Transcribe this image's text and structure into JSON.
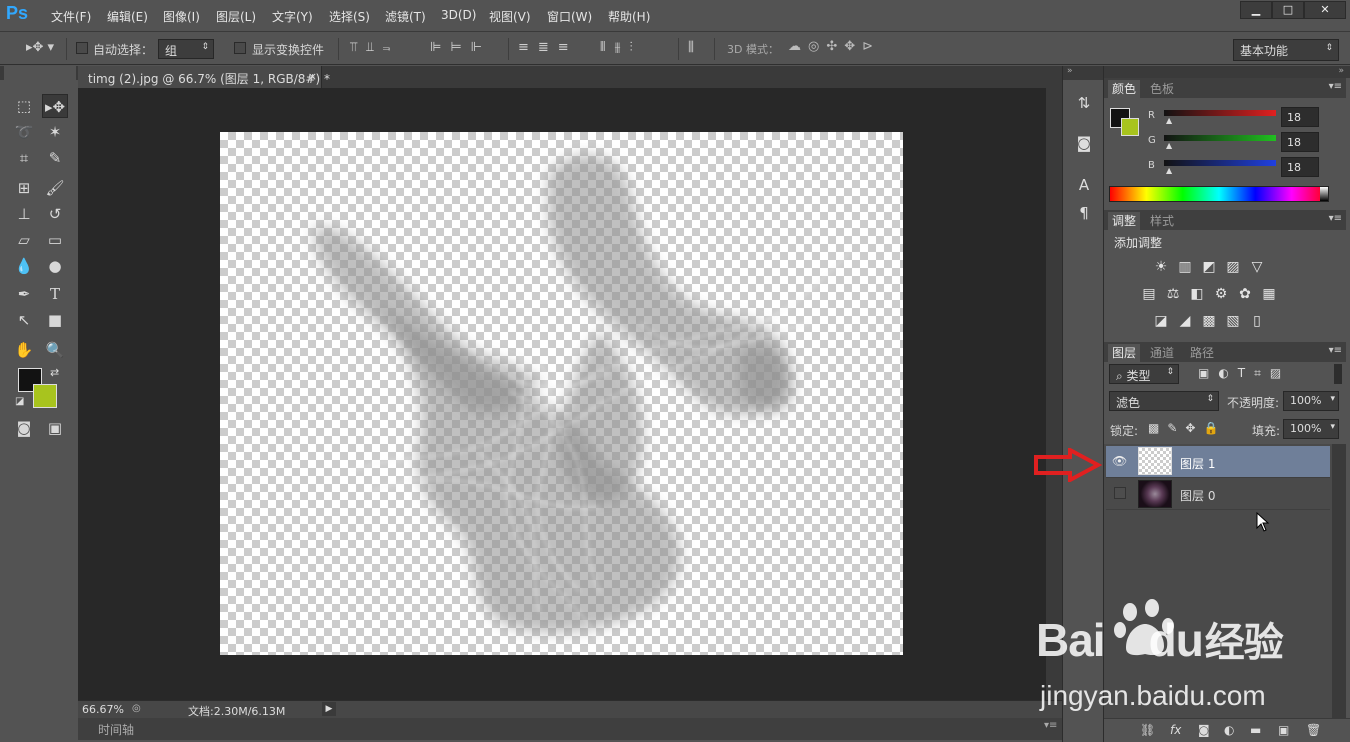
{
  "app": {
    "logo": "Ps",
    "menu": [
      "文件(F)",
      "编辑(E)",
      "图像(I)",
      "图层(L)",
      "文字(Y)",
      "选择(S)",
      "滤镜(T)",
      "3D(D)",
      "视图(V)",
      "窗口(W)",
      "帮助(H)"
    ],
    "window_controls": {
      "minimize": "▁",
      "maximize": "□",
      "close": "✕"
    }
  },
  "options_bar": {
    "auto_select_label": "自动选择：",
    "auto_select_value": "组",
    "show_transform_label": "显示变换控件",
    "mode_3d_label": "3D 模式：",
    "workspace": "基本功能"
  },
  "document": {
    "tab_title": "timg (2).jpg @ 66.7% (图层 1, RGB/8#) *",
    "tab_close": "×",
    "zoom": "66.67%",
    "doc_info": "文档:2.30M/6.13M",
    "timeline_label": "时间轴"
  },
  "color_panel": {
    "tabs": [
      "颜色",
      "色板"
    ],
    "channels": [
      {
        "label": "R",
        "value": "18",
        "color": "#e02020"
      },
      {
        "label": "G",
        "value": "18",
        "color": "#20c020"
      },
      {
        "label": "B",
        "value": "18",
        "color": "#2040e0"
      }
    ],
    "foreground": "#121212",
    "background": "#a8c41e"
  },
  "adjustments_panel": {
    "tabs": [
      "调整",
      "样式"
    ],
    "heading": "添加调整",
    "rows": [
      [
        "☀",
        "▥",
        "◩",
        "▨",
        "▽"
      ],
      [
        "▤",
        "⚖",
        "◧",
        "⚙",
        "✿",
        "▦"
      ],
      [
        "◪",
        "◢",
        "▩",
        "▧",
        "▯"
      ]
    ]
  },
  "layers_panel": {
    "tabs": [
      "图层",
      "通道",
      "路径"
    ],
    "filter_kind": "类型",
    "blend_mode": "滤色",
    "opacity_label": "不透明度:",
    "opacity_value": "100%",
    "lock_label": "锁定:",
    "fill_label": "填充:",
    "fill_value": "100%",
    "layers": [
      {
        "name": "图层 1",
        "visible": true,
        "selected": true
      },
      {
        "name": "图层 0",
        "visible": false,
        "selected": false
      }
    ],
    "footer_icons": [
      "link-icon",
      "fx-icon",
      "mask-icon",
      "adjustment-icon",
      "folder-icon",
      "new-layer-icon",
      "trash-icon"
    ]
  },
  "watermark": {
    "brand": "Bai",
    "brand2": "du",
    "brand3": "经验",
    "url": "jingyan.baidu.com"
  },
  "colors": {
    "accent": "#31a8ff",
    "selected_layer": "#6f7f99",
    "arrow": "#e02020"
  }
}
